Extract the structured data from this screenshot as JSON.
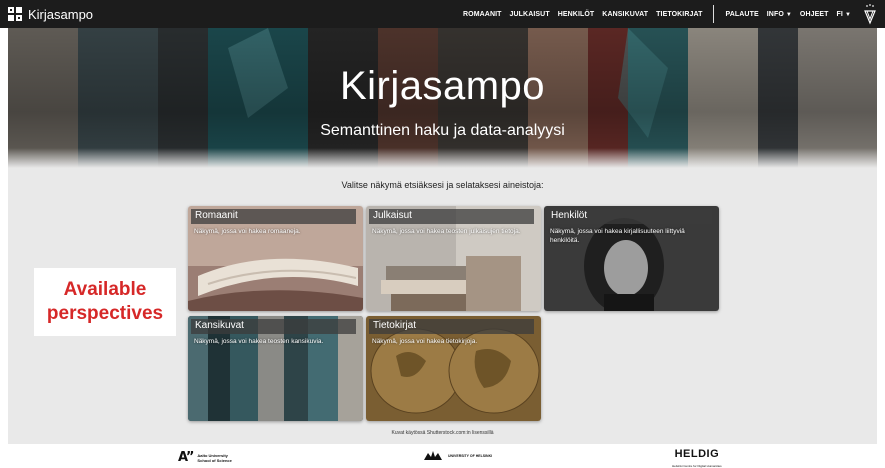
{
  "navbar": {
    "brand": "Kirjasampo",
    "links": [
      "ROMAANIT",
      "JULKAISUT",
      "HENKILÖT",
      "KANSIKUVAT",
      "TIETOKIRJAT"
    ],
    "feedback": "PALAUTE",
    "info": "INFO",
    "instructions": "OHJEET",
    "language": "FI"
  },
  "hero": {
    "title": "Kirjasampo",
    "subtitle": "Semanttinen haku ja data-analyysi"
  },
  "intro": "Valitse näkymä etsiäksesi ja selataksesi aineistoja:",
  "annotation": [
    "Available",
    "perspectives"
  ],
  "cards": [
    {
      "title": "Romaanit",
      "description": "Näkymä, jossa voi hakea romaaneja."
    },
    {
      "title": "Julkaisut",
      "description": "Näkymä, jossa voi hakea teosten julkaisujen tietoja."
    },
    {
      "title": "Henkilöt",
      "description": "Näkymä, jossa voi hakea kirjallisuuteen liittyviä henkilöitä."
    },
    {
      "title": "Kansikuvat",
      "description": "Näkymä, jossa voi hakea teosten kansikuvia."
    },
    {
      "title": "Tietokirjat",
      "description": "Näkymä, jossa voi hakea tietokirjoja."
    }
  ],
  "credit": "Kuvat käytössä Shutterstock.com:in lisenssillä",
  "footer": {
    "aalto_line1": "Aalto University",
    "aalto_line2": "School of Science",
    "helsinki": "UNIVERSITY OF HELSINKI",
    "heldig": "HELDIG",
    "heldig_sub": "Helsinki Centre for Digital Humanities"
  },
  "colors": {
    "navbar": "#1c1c1c",
    "content_bg": "#e9e9e9",
    "annotation_text": "#d62828",
    "card_title_bg": "#3c3c3c"
  },
  "icons": {
    "brand": "book-grid-icon",
    "sampo": "sampo-logo-icon",
    "caret": "chevron-down-icon"
  }
}
